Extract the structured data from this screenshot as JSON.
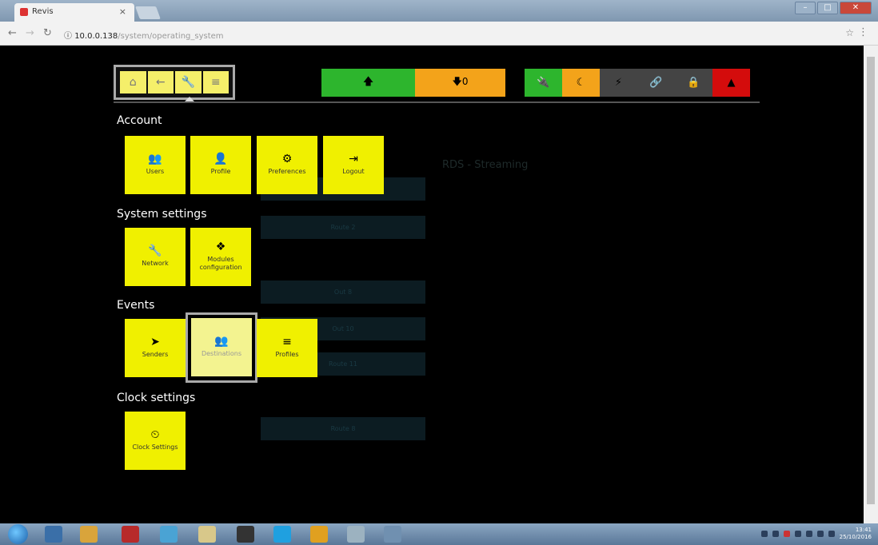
{
  "browser": {
    "tab_title": "Revis",
    "tab_close": "×",
    "url_host": "10.0.0.138",
    "url_path": "/system/operating_system",
    "icons": [
      "back-arrow-icon",
      "forward-arrow-icon",
      "reload-icon",
      "info-icon",
      "star-icon",
      "menu-icon"
    ]
  },
  "topnav": {
    "buttons": [
      {
        "name": "home",
        "glyph": "⌂"
      },
      {
        "name": "back",
        "glyph": "←"
      },
      {
        "name": "tools",
        "glyph": "🔧"
      },
      {
        "name": "menu",
        "glyph": "≡"
      }
    ]
  },
  "updown": {
    "up_glyph": "🡅",
    "down_label": "🡇0"
  },
  "status": [
    {
      "name": "plug",
      "glyph": "🔌",
      "color": "#2db52d"
    },
    {
      "name": "moon",
      "glyph": "☾",
      "color": "#f3a31a"
    },
    {
      "name": "bolt",
      "glyph": "⚡",
      "color": "#444444"
    },
    {
      "name": "link",
      "glyph": "🔗",
      "color": "#444444"
    },
    {
      "name": "lock",
      "glyph": "🔒",
      "color": "#444444"
    },
    {
      "name": "warning",
      "glyph": "▲",
      "color": "#d40c0c"
    }
  ],
  "sections": {
    "account": "Account",
    "system": "System settings",
    "events": "Events",
    "clock": "Clock settings"
  },
  "tiles": {
    "users": "Users",
    "profile": "Profile",
    "preferences": "Preferences",
    "logout": "Logout",
    "network": "Network",
    "modules": "Modules configuration",
    "senders": "Senders",
    "destinations": "Destinations",
    "profiles": "Profiles",
    "clock_settings": "Clock Settings"
  },
  "background": {
    "rds": "RDS - Streaming",
    "ghost_buttons": [
      "",
      "Route 2",
      "Out 8",
      "Out 10",
      "Route 11",
      "Route 8"
    ]
  },
  "taskbar": {
    "time": "13:41",
    "date": "25/10/2016"
  },
  "colors": {
    "tile": "#f0f000",
    "accent_green": "#2db52d",
    "accent_orange": "#f3a31a",
    "alert_red": "#d40c0c"
  }
}
